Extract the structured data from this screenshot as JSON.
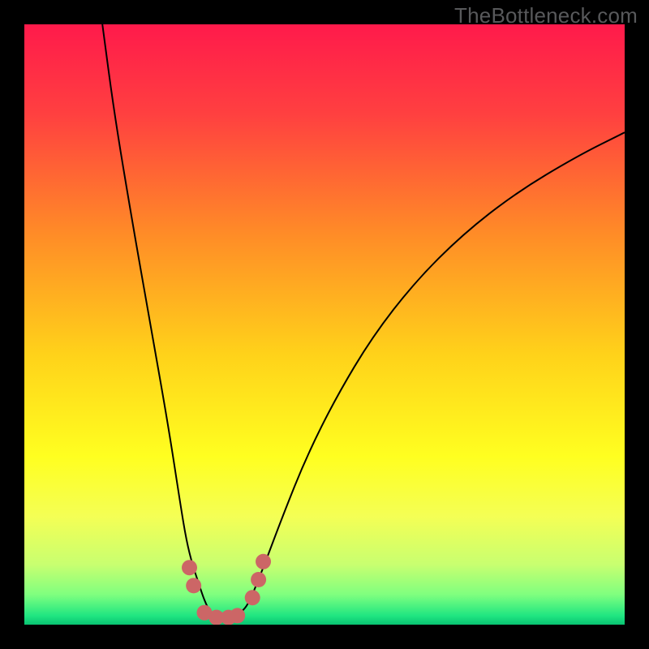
{
  "watermark": "TheBottleneck.com",
  "chart_data": {
    "type": "line",
    "title": "",
    "xlabel": "",
    "ylabel": "",
    "xlim": [
      0,
      100
    ],
    "ylim": [
      0,
      100
    ],
    "grid": false,
    "legend": false,
    "series": [
      {
        "name": "bottleneck-curve",
        "x": [
          13,
          15,
          18,
          21,
          24,
          26,
          27,
          28,
          29,
          30,
          31,
          32,
          33,
          34,
          35,
          36,
          37,
          38,
          40,
          43,
          47,
          52,
          58,
          65,
          73,
          82,
          92,
          100
        ],
        "y": [
          100,
          85,
          67,
          50,
          33,
          20,
          14,
          10,
          7,
          4,
          2,
          1,
          1,
          1,
          1,
          2,
          3,
          5,
          10,
          18,
          28,
          38,
          48,
          57,
          65,
          72,
          78,
          82
        ]
      }
    ],
    "optimal_markers": {
      "name": "optimal-range-dots",
      "color": "#cc6666",
      "points": [
        {
          "x": 27.5,
          "y": 9.5
        },
        {
          "x": 28.2,
          "y": 6.5
        },
        {
          "x": 30.0,
          "y": 2.0
        },
        {
          "x": 32.0,
          "y": 1.2
        },
        {
          "x": 34.0,
          "y": 1.2
        },
        {
          "x": 35.5,
          "y": 1.5
        },
        {
          "x": 38.0,
          "y": 4.5
        },
        {
          "x": 39.0,
          "y": 7.5
        },
        {
          "x": 39.8,
          "y": 10.5
        }
      ]
    },
    "background_gradient": {
      "stops": [
        {
          "offset": 0.0,
          "color": "#ff1a4b"
        },
        {
          "offset": 0.15,
          "color": "#ff4040"
        },
        {
          "offset": 0.35,
          "color": "#ff8c27"
        },
        {
          "offset": 0.55,
          "color": "#ffd21a"
        },
        {
          "offset": 0.72,
          "color": "#ffff20"
        },
        {
          "offset": 0.82,
          "color": "#f4ff55"
        },
        {
          "offset": 0.9,
          "color": "#c8ff70"
        },
        {
          "offset": 0.95,
          "color": "#7fff7f"
        },
        {
          "offset": 0.985,
          "color": "#20e681"
        },
        {
          "offset": 1.0,
          "color": "#09c372"
        }
      ]
    }
  }
}
